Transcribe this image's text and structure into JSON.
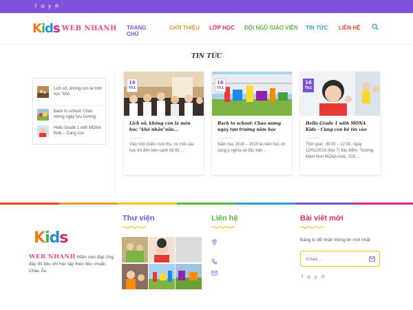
{
  "topbar": {
    "socials": [
      {
        "icon": "facebook-icon",
        "glyph": "f"
      },
      {
        "icon": "instagram-icon",
        "glyph": "◎"
      },
      {
        "icon": "twitter-icon",
        "glyph": "y"
      },
      {
        "icon": "pinterest-icon",
        "glyph": "℗"
      }
    ]
  },
  "header": {
    "logo_kids": [
      "K",
      "i",
      "d",
      "s"
    ],
    "logo_web": "WEB NHANH",
    "nav": [
      "TRANG CHỦ",
      "GIỚI THIỆU",
      "LỚP HỌC",
      "ĐỘI NGŨ GIÁO VIÊN",
      "TIN TỨC",
      "LIÊN HỆ"
    ],
    "search_icon": "search-icon"
  },
  "section_title": "TIN TỨC",
  "sidebar": {
    "items": [
      {
        "label": "Lịch sử, không còn là môn học \"khô"
      },
      {
        "label": "Back to school: Chào mừng ngày tựu trường"
      },
      {
        "label": "Hello Grade 1 with MONA Kids – Cùng con"
      }
    ]
  },
  "cards": [
    {
      "day": "16",
      "month": "Th1",
      "title": "Lịch sử, không còn là môn học \"khô nhần\"nữa...",
      "excerpt": "Vào một chiều cuối thu, có một cậu học trò đến bên cạnh tôi thì ..."
    },
    {
      "day": "16",
      "month": "Th1",
      "title": "Back to school: Chào mừng ngày tựu trường năm học",
      "excerpt": "Năm học 2018 – 2019 là năm học vô cùng ý nghĩa và đặc biệt ..."
    },
    {
      "day": "16",
      "month": "Th1",
      "title": "Hello Grade 1 with MONA Kids - Cùng con bé tin vào",
      "excerpt": "Thời gian: 09:00 – 12:00, ngày 12/01/2019 (thứ 7) Địa điểm: Trường Mầm Non MONA Kids, 319 ..."
    }
  ],
  "footer": {
    "logo_kids": [
      "K",
      "i",
      "d",
      "s"
    ],
    "logo_web": "WEB NHANH",
    "description": " Mầm non đáp ứng đầy đủ tiêu chí học tập theo tiêu chuẩn Châu Âu",
    "gallery_title": "Thư viện",
    "contact_title": "Liên hệ",
    "news_title": "Bài viết mới",
    "news_text": "Đăng kí để nhận thông tin mới nhất",
    "email_placeholder": "Email ...",
    "socials": [
      {
        "icon": "facebook-icon",
        "glyph": "f"
      },
      {
        "icon": "instagram-icon",
        "glyph": "◎"
      },
      {
        "icon": "twitter-icon",
        "glyph": "y"
      },
      {
        "icon": "pinterest-icon",
        "glyph": "℗"
      }
    ]
  },
  "colors": {
    "primary": "#7b52d9",
    "rainbow": [
      "#e84b2a",
      "#e69a2d",
      "#f0c419",
      "#5bb744",
      "#2c9fd6",
      "#7b52d9",
      "#d7267f"
    ]
  }
}
